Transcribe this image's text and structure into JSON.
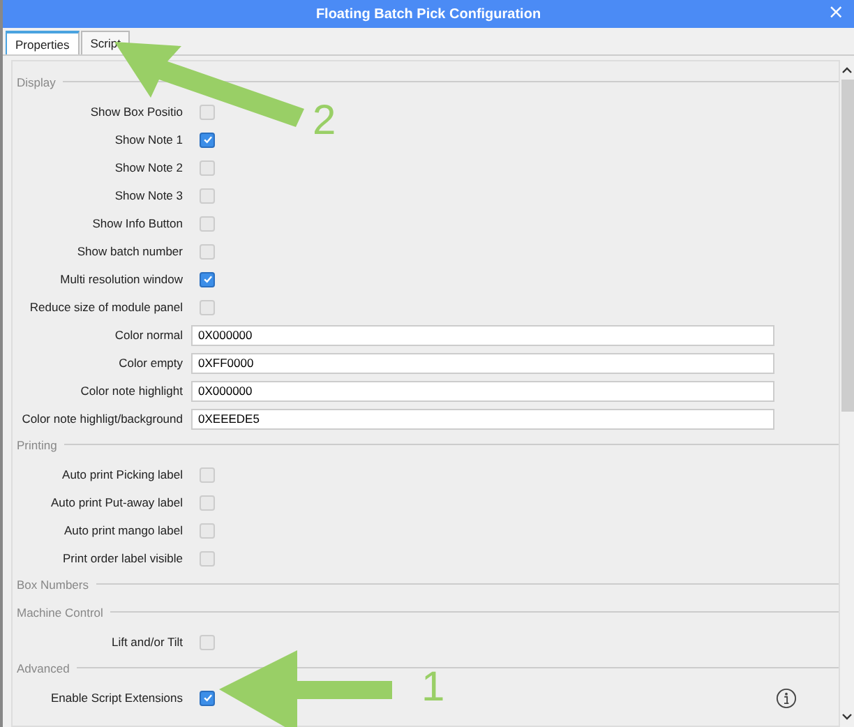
{
  "window": {
    "title": "Floating Batch Pick Configuration",
    "close": "×"
  },
  "tabs": [
    {
      "label": "Properties",
      "selected": true
    },
    {
      "label": "Script",
      "selected": false
    }
  ],
  "sections": [
    {
      "title": "Display",
      "items": [
        {
          "kind": "checkbox",
          "label": "Show Box Positio",
          "checked": false
        },
        {
          "kind": "checkbox",
          "label": "Show Note 1",
          "checked": true
        },
        {
          "kind": "checkbox",
          "label": "Show Note 2",
          "checked": false
        },
        {
          "kind": "checkbox",
          "label": "Show Note 3",
          "checked": false
        },
        {
          "kind": "checkbox",
          "label": "Show Info Button",
          "checked": false
        },
        {
          "kind": "checkbox",
          "label": "Show batch number",
          "checked": false
        },
        {
          "kind": "checkbox",
          "label": "Multi resolution window",
          "checked": true
        },
        {
          "kind": "checkbox",
          "label": "Reduce size of module panel",
          "checked": false
        },
        {
          "kind": "text",
          "label": "Color normal",
          "value": "0X000000"
        },
        {
          "kind": "text",
          "label": "Color empty",
          "value": "0XFF0000"
        },
        {
          "kind": "text",
          "label": "Color note highlight",
          "value": "0X000000"
        },
        {
          "kind": "text",
          "label": "Color note highligt/background",
          "value": "0XEEEDE5"
        }
      ]
    },
    {
      "title": "Printing",
      "items": [
        {
          "kind": "checkbox",
          "label": "Auto print Picking label",
          "checked": false
        },
        {
          "kind": "checkbox",
          "label": "Auto print Put-away label",
          "checked": false
        },
        {
          "kind": "checkbox",
          "label": "Auto print mango label",
          "checked": false
        },
        {
          "kind": "checkbox",
          "label": "Print order label visible",
          "checked": false
        }
      ]
    },
    {
      "title": "Box Numbers"
    },
    {
      "title": "Machine Control",
      "items": [
        {
          "kind": "checkbox",
          "label": "Lift and/or Tilt",
          "checked": false
        }
      ]
    },
    {
      "title": "Advanced",
      "items": [
        {
          "kind": "checkbox",
          "label": "Enable Script Extensions",
          "checked": true
        }
      ]
    }
  ],
  "annotations": [
    {
      "label": "2",
      "kind": "diagonal"
    },
    {
      "label": "1",
      "kind": "horizontal"
    }
  ]
}
